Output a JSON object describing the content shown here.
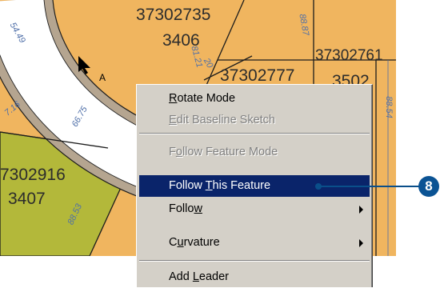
{
  "map": {
    "parcels": [
      {
        "id": "top-parcel-number",
        "text": "37302735"
      },
      {
        "id": "top-parcel-lot",
        "text": "3406"
      },
      {
        "id": "right-parcel-number",
        "text": "37302761"
      },
      {
        "id": "middle-parcel-number",
        "text": "37302777"
      },
      {
        "id": "middle-parcel-lot",
        "text": "3502"
      },
      {
        "id": "left-parcel-number",
        "text": "7302916"
      },
      {
        "id": "left-parcel-lot",
        "text": "3407"
      }
    ],
    "dimensions": [
      "54.49",
      "81.21",
      "88.87",
      "20",
      "7.16",
      "66.75",
      "88.54",
      "88.53"
    ],
    "cursor_label": "A",
    "colors": {
      "parcel": "#f0b55f",
      "parcel_green": "#b3b83a",
      "road": "#ffffff",
      "curb": "#b5a590",
      "line": "#1c1c1c"
    }
  },
  "context_menu": {
    "items": [
      {
        "id": "rotate-mode",
        "pre": "",
        "u": "R",
        "post": "otate Mode",
        "enabled": true,
        "highlighted": false,
        "submenu": false
      },
      {
        "id": "edit-baseline-sketch",
        "pre": "",
        "u": "E",
        "post": "dit Baseline Sketch",
        "enabled": false,
        "highlighted": false,
        "submenu": false
      },
      {
        "sep": true
      },
      {
        "id": "follow-feature-mode",
        "pre": "F",
        "u": "o",
        "post": "llow Feature Mode",
        "enabled": false,
        "highlighted": false,
        "submenu": false
      },
      {
        "id": "follow-this-feature",
        "pre": "Follow ",
        "u": "T",
        "post": "his Feature",
        "enabled": true,
        "highlighted": true,
        "submenu": false
      },
      {
        "id": "follow",
        "pre": "Follo",
        "u": "w",
        "post": "",
        "enabled": true,
        "highlighted": false,
        "submenu": true
      },
      {
        "id": "curvature",
        "pre": "C",
        "u": "u",
        "post": "rvature",
        "enabled": true,
        "highlighted": false,
        "submenu": true
      },
      {
        "sep": true
      },
      {
        "id": "add-leader",
        "pre": "Add ",
        "u": "L",
        "post": "eader",
        "enabled": true,
        "highlighted": false,
        "submenu": false
      }
    ]
  },
  "callout": {
    "number": "8",
    "color": "#0b5394"
  }
}
